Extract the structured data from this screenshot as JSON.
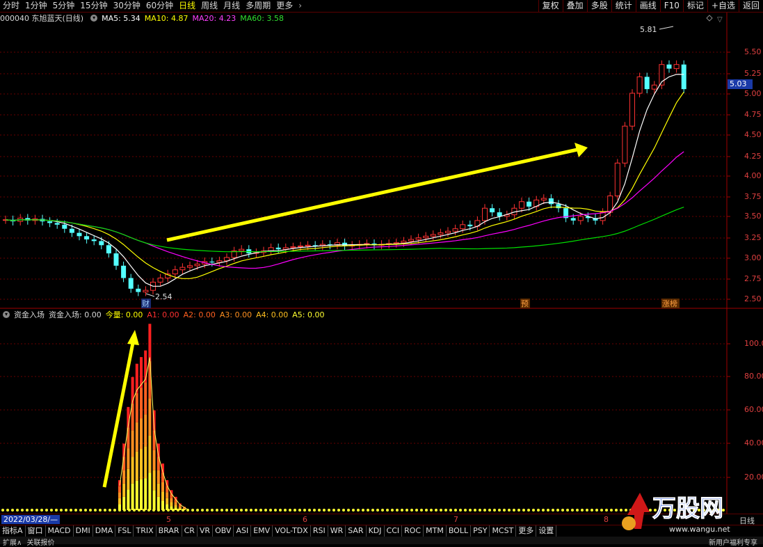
{
  "toolbar": {
    "periods": [
      "分时",
      "1分钟",
      "5分钟",
      "15分钟",
      "30分钟",
      "60分钟",
      "日线",
      "周线",
      "月线",
      "多周期",
      "更多"
    ],
    "active_period": "日线",
    "right_buttons": [
      "复权",
      "叠加",
      "多股",
      "统计",
      "画线",
      "F10",
      "标记",
      "+自选",
      "返回"
    ]
  },
  "stock": {
    "title": "000040 东旭蓝天(日线)",
    "ma5": "MA5: 5.34",
    "ma10": "MA10: 4.87",
    "ma20": "MA20: 4.23",
    "ma60": "MA60: 3.58",
    "current_price_tag": "5.03",
    "high_label": "5.81",
    "low_label": "2.54"
  },
  "price_axis": [
    "5.50",
    "5.25",
    "5.00",
    "4.75",
    "4.50",
    "4.25",
    "4.00",
    "3.75",
    "3.50",
    "3.25",
    "3.00",
    "2.75",
    "2.50"
  ],
  "indicator": {
    "name": "资金入场",
    "value": "资金入场: 0.00",
    "jinliang": "今量: 0.00",
    "a1": "A1: 0.00",
    "a2": "A2: 0.00",
    "a3": "A3: 0.00",
    "a4": "A4: 0.00",
    "a5": "A5: 0.00",
    "axis": [
      "100.0",
      "80.00",
      "60.00",
      "40.00",
      "20.00"
    ]
  },
  "markers": {
    "cai": "财",
    "yu": "预",
    "zhang": "涨榜"
  },
  "dates": {
    "current": "2022/03/28/—",
    "months": [
      "5",
      "6",
      "7",
      "8"
    ],
    "right": "日线"
  },
  "tabs": [
    "指标A",
    "窗口",
    "MACD",
    "DMI",
    "DMA",
    "FSL",
    "TRIX",
    "BRAR",
    "CR",
    "VR",
    "OBV",
    "ASI",
    "EMV",
    "VOL-TDX",
    "RSI",
    "WR",
    "SAR",
    "KDJ",
    "CCI",
    "ROC",
    "MTM",
    "BOLL",
    "PSY",
    "MCST",
    "更多",
    "设置"
  ],
  "bottom": {
    "left1": "扩展∧",
    "left2": "关联报价",
    "right": "新用户福利专享"
  },
  "watermark": {
    "text": "万股网",
    "site": "www.wangu.net"
  },
  "colors": {
    "up": "#ff3232",
    "down": "#54ffff",
    "ma5": "#ffffff",
    "ma10": "#ffff00",
    "ma20": "#ff00ff",
    "ma60": "#00e000"
  }
}
